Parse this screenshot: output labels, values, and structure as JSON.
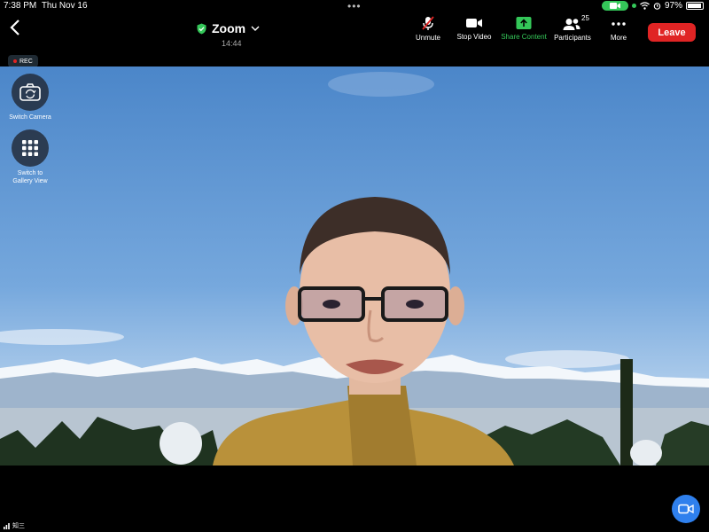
{
  "status_bar": {
    "time": "7:38 PM",
    "date": "Thu Nov 16",
    "battery": "97%"
  },
  "header": {
    "title": "Zoom",
    "timer": "14:44"
  },
  "toolbar": {
    "unmute": "Unmute",
    "stop_video": "Stop Video",
    "share_content": "Share Content",
    "participants": "Participants",
    "participants_count": "25",
    "more": "More",
    "leave": "Leave"
  },
  "recording": {
    "label": "REC"
  },
  "side_controls": {
    "switch_camera": "Switch Camera",
    "gallery_view_line1": "Switch to",
    "gallery_view_line2": "Gallery View"
  },
  "footer": {
    "network_name": "知三"
  },
  "colors": {
    "leave": "#e02424",
    "share": "#34c759",
    "video_fab": "#2f80ed"
  }
}
